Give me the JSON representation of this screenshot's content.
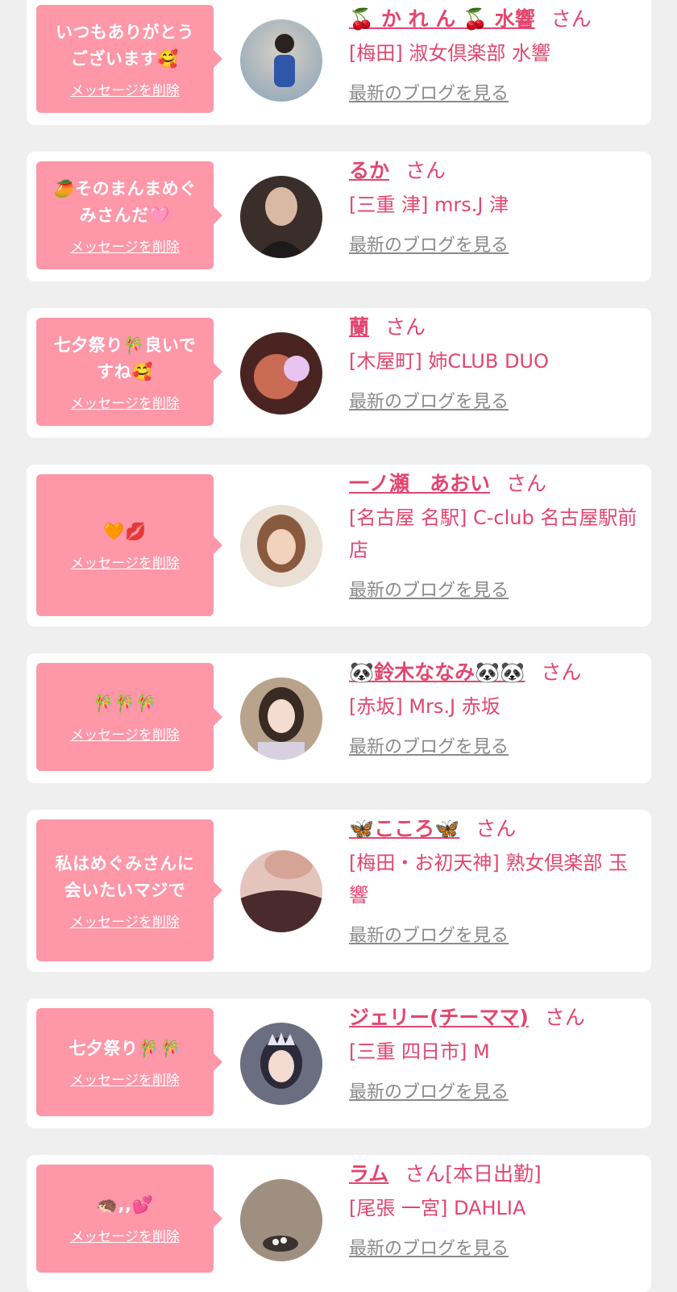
{
  "items": [
    {
      "message": "いつもありがとう\nございます🥰",
      "delete_label": "メッセージを削除",
      "name": "🍒 か れ ん 🍒 水響",
      "san": "さん",
      "store": "[梅田] 淑女倶楽部 水響",
      "blog_label": "最新のブログを見る",
      "avatar_color": "#8fa7b9"
    },
    {
      "message": "🥭そのまんまめぐ\nみさんだ🩷",
      "delete_label": "メッセージを削除",
      "name": "るか",
      "san": "さん",
      "store": "[三重 津] mrs.J 津",
      "blog_label": "最新のブログを見る",
      "avatar_color": "#3a2e2a"
    },
    {
      "message": "七夕祭り🎋良いで\nすね🥰",
      "delete_label": "メッセージを削除",
      "name": "蘭",
      "san": "さん",
      "store": "[木屋町] 姉CLUB DUO",
      "blog_label": "最新のブログを見る",
      "avatar_color": "#6b3a34"
    },
    {
      "message": "🧡💋",
      "delete_label": "メッセージを削除",
      "name": "一ノ瀬　あおい",
      "san": "さん",
      "store": "[名古屋 名駅] C-club 名古屋駅前店",
      "blog_label": "最新のブログを見る",
      "avatar_color": "#c9a58a"
    },
    {
      "message": "🎋🎋🎋",
      "delete_label": "メッセージを削除",
      "name": "🐼鈴木ななみ🐼🐼",
      "san": "さん",
      "store": "[赤坂] Mrs.J 赤坂",
      "blog_label": "最新のブログを見る",
      "avatar_color": "#b9a38c"
    },
    {
      "message": "私はめぐみさんに\n会いたいマジで",
      "delete_label": "メッセージを削除",
      "name": "🦋こころ🦋",
      "san": "さん",
      "store": "[梅田・お初天神] 熟女倶楽部 玉響",
      "blog_label": "最新のブログを見る",
      "avatar_color": "#4a2a2c"
    },
    {
      "message": "七夕祭り🎋🎋",
      "delete_label": "メッセージを削除",
      "name": "ジェリー(チーママ)",
      "san": "さん",
      "store": "[三重 四日市] M",
      "blog_label": "最新のブログを見る",
      "avatar_color": "#6a6e80"
    },
    {
      "message": "🦔,,💕",
      "delete_label": "メッセージを削除",
      "name": "ラム",
      "san": "さん[本日出勤]",
      "store": "[尾張 一宮] DAHLIA",
      "blog_label": "最新のブログを見る",
      "avatar_color": "#9e8f80"
    }
  ]
}
